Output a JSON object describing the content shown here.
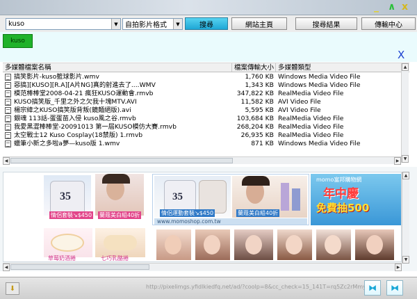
{
  "window": {
    "minimize": "_",
    "maximize": "∧",
    "close": "x"
  },
  "toolbar": {
    "search_value": "kuso",
    "format_value": "自拍影片格式",
    "search_button": "搜尋",
    "home_button": "網站主頁",
    "results_button": "搜尋結果",
    "upload_button": "傳輸中心"
  },
  "nav": {
    "tab_label": "kuso",
    "close": "X"
  },
  "list": {
    "columns": [
      "多媒體檔案名稱",
      "檔案傳輸大小",
      "多媒體類型"
    ],
    "rows": [
      {
        "name": "搞笑影片-kuso籃球影片.wmv",
        "size": "1,760 KB",
        "type": "Windows Media Video File"
      },
      {
        "name": "惡搞][KUSO][R.A][A片NG]真的射進去了....WMV",
        "size": "1,343 KB",
        "type": "Windows Media Video File"
      },
      {
        "name": "模范棒棒堂2008-04-21 瘋狂KUSO運動會.rmvb",
        "size": "347,822 KB",
        "type": "RealMedia Video File"
      },
      {
        "name": "KUSO搞笑版_千里之外之欠我十塊MTV.AVI",
        "size": "11,582 KB",
        "type": "AVI Video File"
      },
      {
        "name": "楊宗緯之KUSO搞笑版背叛(鏡麵絕版).avi",
        "size": "5,595 KB",
        "type": "AVI Video File"
      },
      {
        "name": "銀魂 113話-蛋蛋苗入侵 kuso風之谷.rmvb",
        "size": "103,684 KB",
        "type": "RealMedia Video File"
      },
      {
        "name": "我愛黑澀棒棒堂-20091013 第一屆KUSO模仿大賽.rmvb",
        "size": "268,204 KB",
        "type": "RealMedia Video File"
      },
      {
        "name": "太空戰士12 Kuso Cosplay(18禁版) 1.rmvb",
        "size": "26,935 KB",
        "type": "RealMedia Video File"
      },
      {
        "name": "蠟筆小新之多啦a夢—kuso版 1.wmv",
        "size": "871 KB",
        "type": "Windows Media Video File"
      }
    ]
  },
  "ads": {
    "left_top_caption": "情侶套裝↘$450",
    "left_top_caption2": "蘭蔻美白組40折",
    "middle_caption1": "情侶運動套裝↘$450",
    "middle_caption2": "蘭蔻美白組40折",
    "shop_url": "www.momoshop.com.tw",
    "momo_label": "momo富邦購物網",
    "promo_title": "年中慶",
    "promo_sub": "免費抽500",
    "left_bottom_caption": "草莓奶酒捲",
    "left_bottom_caption2": "七巧乳酪捲"
  },
  "status": {
    "url_text": "http://pixelimgs.yfidlkiedfq.net/ad/?coolp=8&cc_check=15_141T=rq5Zc2rMmy"
  },
  "colors": {
    "accent": "#1ea7d6",
    "green_tab": "#20b22a",
    "close_x": "#1a3fd0"
  }
}
